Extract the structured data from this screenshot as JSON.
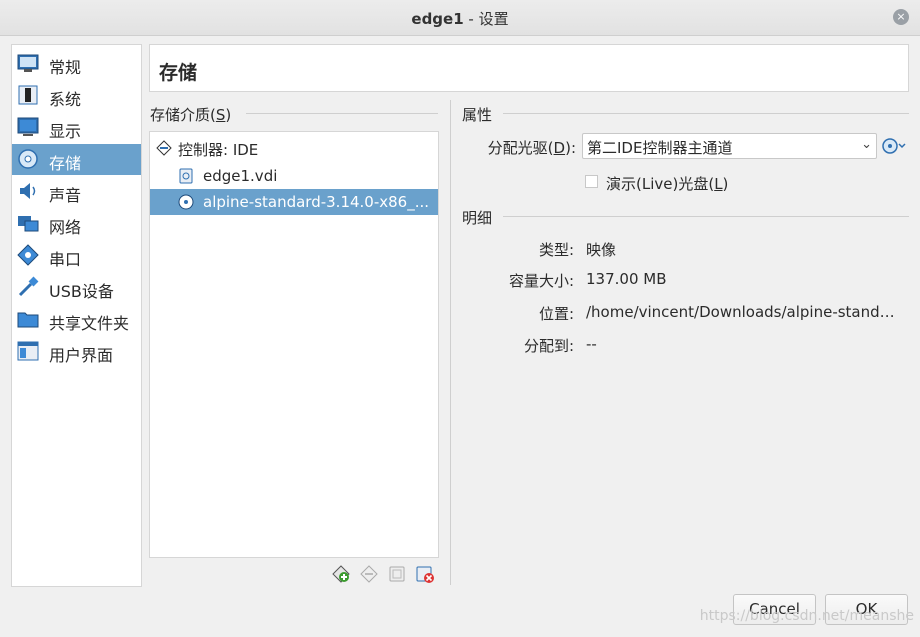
{
  "window": {
    "title_bold": "edge1",
    "title_rest": " - 设置",
    "close_glyph": "×"
  },
  "sidebar": {
    "items": [
      {
        "label": "常规",
        "icon": "general-icon"
      },
      {
        "label": "系统",
        "icon": "system-icon"
      },
      {
        "label": "显示",
        "icon": "display-icon"
      },
      {
        "label": "存储",
        "icon": "storage-icon",
        "active": true
      },
      {
        "label": "声音",
        "icon": "audio-icon"
      },
      {
        "label": "网络",
        "icon": "network-icon"
      },
      {
        "label": "串口",
        "icon": "serial-port-icon"
      },
      {
        "label": "USB设备",
        "icon": "usb-icon"
      },
      {
        "label": "共享文件夹",
        "icon": "shared-folder-icon"
      },
      {
        "label": "用户界面",
        "icon": "user-interface-icon"
      }
    ]
  },
  "header": {
    "title": "存储"
  },
  "storage_devices": {
    "section_title": "存储介质(",
    "section_key": "S",
    "section_end": ")",
    "tree": [
      {
        "label": "控制器: IDE",
        "type": "controller"
      },
      {
        "label": "edge1.vdi",
        "type": "hard-disk"
      },
      {
        "label": "alpine-standard-3.14.0-x86_...",
        "type": "optical-disk",
        "selected": true
      }
    ]
  },
  "attributes": {
    "section_title": "属性",
    "drive_label_pre": "分配光驱(",
    "drive_label_key": "D",
    "drive_label_post": "):",
    "drive_value": "第二IDE控制器主通道",
    "live_cd_pre": "演示(Live)光盘(",
    "live_cd_key": "L",
    "live_cd_post": ")",
    "live_cd_checked": false
  },
  "details": {
    "section_title": "明细",
    "rows": [
      {
        "label": "类型:",
        "value": "映像"
      },
      {
        "label": "容量大小:",
        "value": "137.00 MB"
      },
      {
        "label": "位置:",
        "value": "/home/vincent/Downloads/alpine-stand…"
      },
      {
        "label": "分配到:",
        "value": "--"
      }
    ]
  },
  "buttons": {
    "cancel": "Cancel",
    "ok": "OK"
  },
  "watermark": "https://blog.csdn.net/meanshe",
  "colors": {
    "selection": "#6aa1cc",
    "accent": "#2f7fc1"
  }
}
